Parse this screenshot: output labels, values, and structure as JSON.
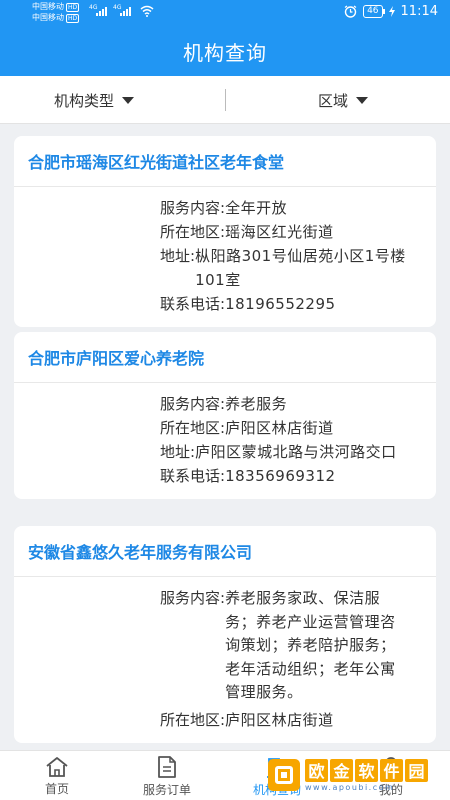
{
  "status_bar": {
    "carrier1": "中国移动",
    "carrier2": "中国移动",
    "hd": "HD",
    "net1": "4G",
    "net2": "4G",
    "battery": "46",
    "time": "11:14"
  },
  "header": {
    "title": "机构查询"
  },
  "filters": {
    "type_label": "机构类型",
    "region_label": "区域"
  },
  "labels": {
    "service": "服务内容:",
    "region": "所在地区:",
    "address": "地址:",
    "phone": "联系电话:"
  },
  "cards": [
    {
      "name": "合肥市瑶海区红光街道社区老年食堂",
      "service": "全年开放",
      "region": "瑶海区红光街道",
      "address": "枞阳路301号仙居苑小区1号楼101室",
      "phone": "18196552295"
    },
    {
      "name": "合肥市庐阳区爱心养老院",
      "service": "养老服务",
      "region": "庐阳区林店街道",
      "address": "庐阳区蒙城北路与洪河路交口",
      "phone": "18356969312"
    },
    {
      "name": "安徽省鑫悠久老年服务有限公司",
      "service": "养老服务家政、保洁服务；养老产业运营管理咨询策划；养老陪护服务；老年活动组织；老年公寓管理服务。",
      "region": "庐阳区林店街道"
    }
  ],
  "bottom_nav": {
    "home": "首页",
    "orders": "服务订单",
    "query": "机构查询",
    "mine": "我的"
  },
  "colors": {
    "primary": "#2196f3",
    "watermark": "#f7a600"
  },
  "watermark": {
    "chars": [
      "欧",
      "金",
      "软",
      "件",
      "园"
    ],
    "url": "www.apoubi.com"
  }
}
